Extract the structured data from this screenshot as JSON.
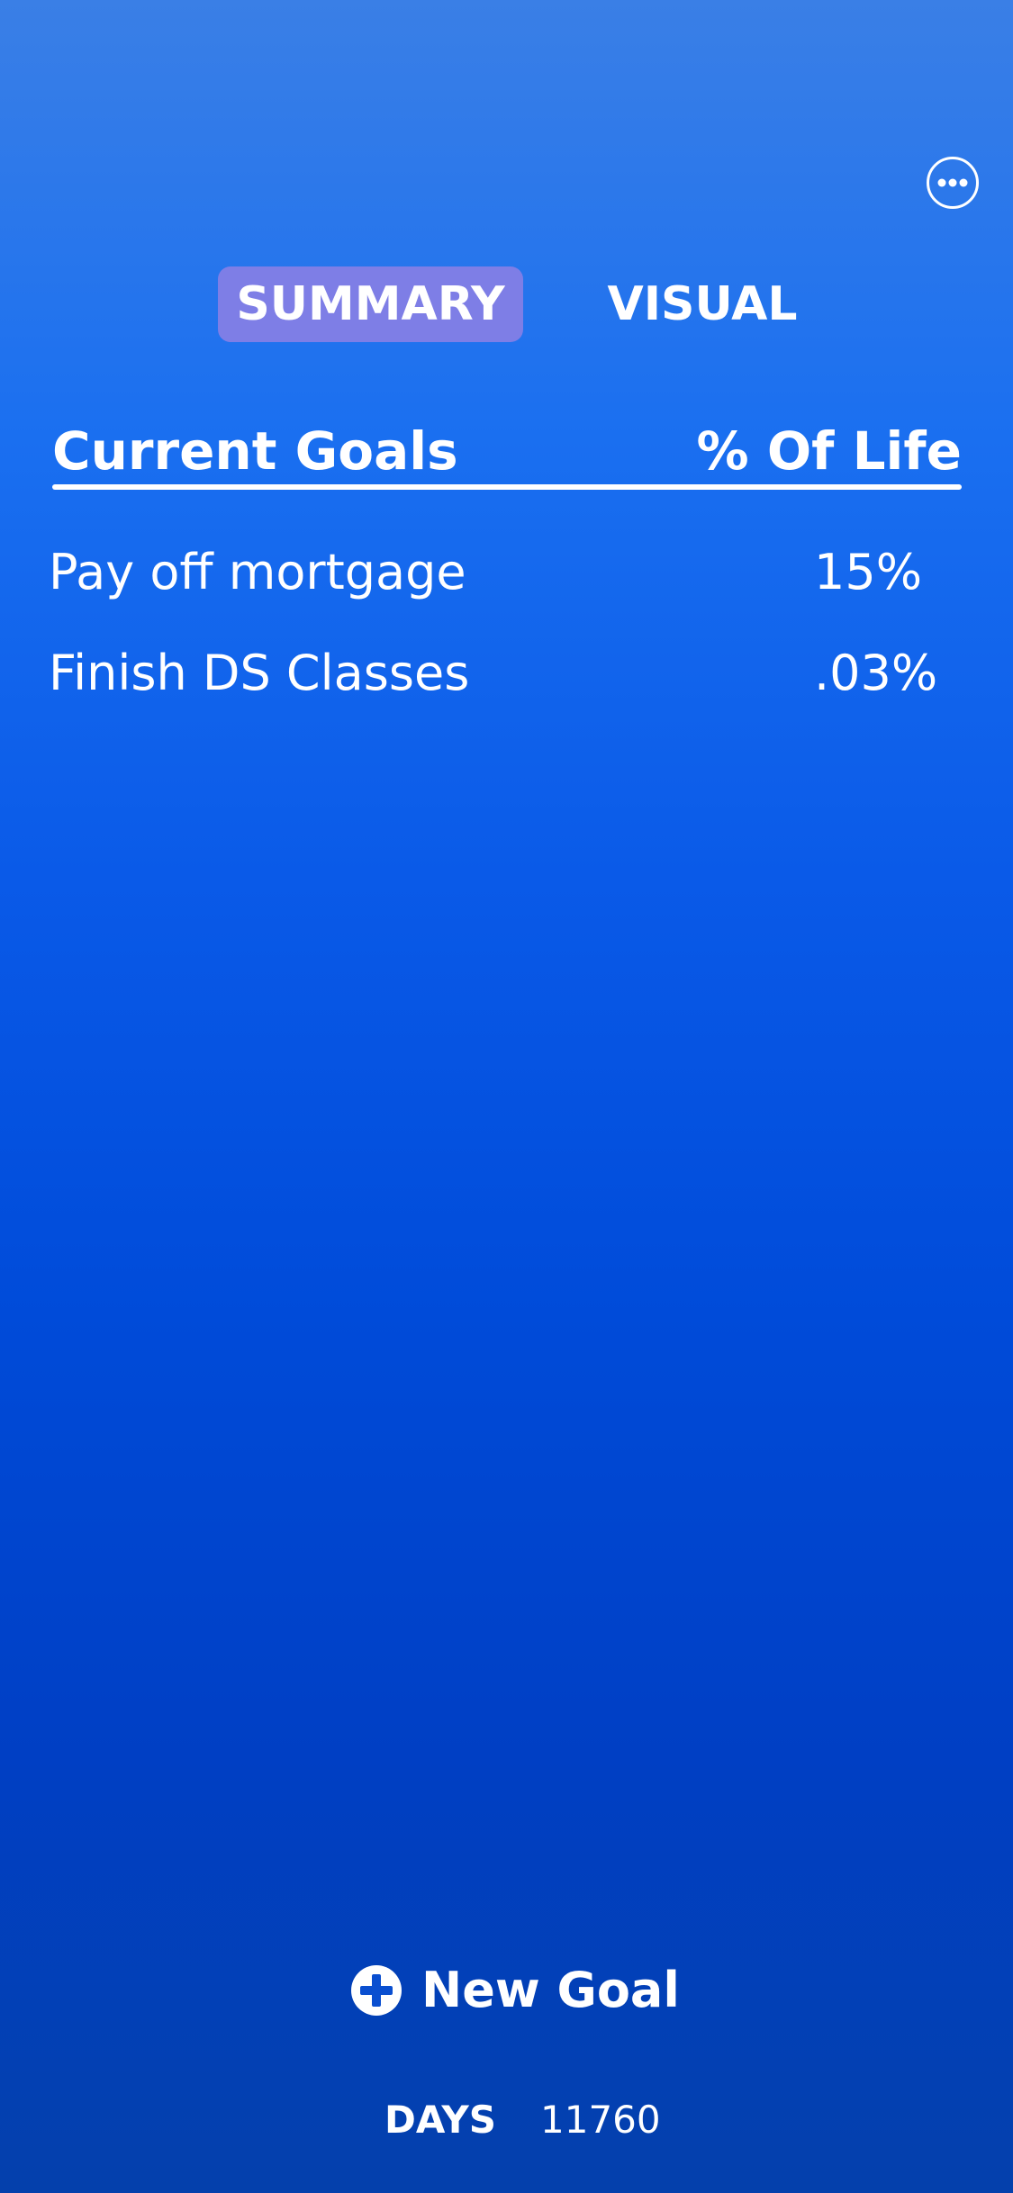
{
  "header": {
    "more_icon": "more-horizontal-icon"
  },
  "tabs": [
    {
      "label": "SUMMARY",
      "active": true
    },
    {
      "label": "VISUAL",
      "active": false
    }
  ],
  "table": {
    "headers": {
      "goal": "Current Goals",
      "percent": "% Of Life"
    },
    "rows": [
      {
        "name": "Pay off mortgage",
        "percent": "15%"
      },
      {
        "name": "Finish DS Classes",
        "percent": ".03%"
      }
    ]
  },
  "actions": {
    "new_goal_label": "New Goal",
    "new_goal_icon": "plus-circle-icon"
  },
  "footer": {
    "days_label": "DAYS",
    "days_value": "11760"
  },
  "colors": {
    "background_top": "#3a7fe6",
    "background_bottom": "#0440ac",
    "active_tab": "#7e7ee6",
    "text": "#ffffff"
  }
}
